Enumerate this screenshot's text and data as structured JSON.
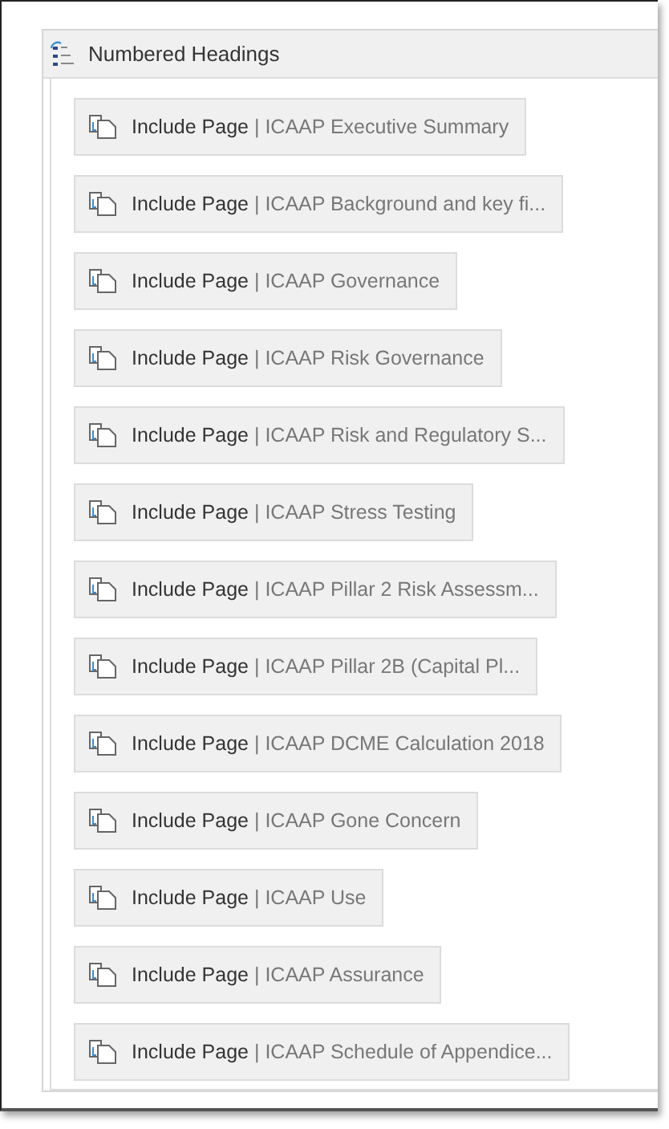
{
  "macro_panel": {
    "title": "Numbered Headings"
  },
  "items": [
    {
      "macro": "Include Page",
      "page": "| ICAAP Executive Summary"
    },
    {
      "macro": "Include Page",
      "page": "| ICAAP Background and key fi..."
    },
    {
      "macro": "Include Page",
      "page": "| ICAAP Governance"
    },
    {
      "macro": "Include Page",
      "page": "| ICAAP Risk Governance"
    },
    {
      "macro": "Include Page",
      "page": "| ICAAP Risk and Regulatory S..."
    },
    {
      "macro": "Include Page",
      "page": "| ICAAP Stress Testing"
    },
    {
      "macro": "Include Page",
      "page": "| ICAAP Pillar 2 Risk Assessm..."
    },
    {
      "macro": "Include Page",
      "page": "| ICAAP Pillar 2B (Capital Pl..."
    },
    {
      "macro": "Include Page",
      "page": "| ICAAP DCME Calculation 2018"
    },
    {
      "macro": "Include Page",
      "page": "| ICAAP Gone Concern"
    },
    {
      "macro": "Include Page",
      "page": "| ICAAP Use"
    },
    {
      "macro": "Include Page",
      "page": "| ICAAP Assurance"
    },
    {
      "macro": "Include Page",
      "page": "| ICAAP Schedule of Appendice..."
    }
  ]
}
